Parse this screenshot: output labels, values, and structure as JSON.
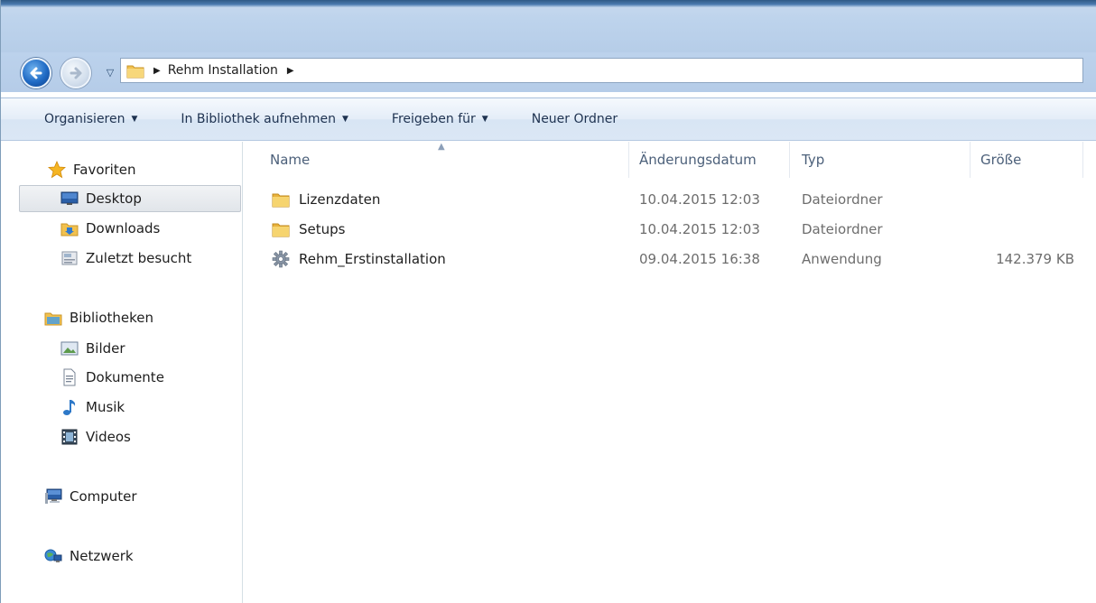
{
  "address": {
    "crumbs": [
      "Rehm Installation"
    ]
  },
  "commands": {
    "organize": "Organisieren",
    "library": "In Bibliothek aufnehmen",
    "share": "Freigeben für",
    "new_folder": "Neuer Ordner"
  },
  "navpane": {
    "favorites": {
      "label": "Favoriten",
      "items": [
        {
          "label": "Desktop",
          "icon": "desktop-icon",
          "selected": true
        },
        {
          "label": "Downloads",
          "icon": "downloads-folder-icon"
        },
        {
          "label": "Zuletzt besucht",
          "icon": "recent-places-icon"
        }
      ]
    },
    "libraries": {
      "label": "Bibliotheken",
      "items": [
        {
          "label": "Bilder",
          "icon": "pictures-icon"
        },
        {
          "label": "Dokumente",
          "icon": "documents-icon"
        },
        {
          "label": "Musik",
          "icon": "music-icon"
        },
        {
          "label": "Videos",
          "icon": "videos-icon"
        }
      ]
    },
    "computer": {
      "label": "Computer"
    },
    "network": {
      "label": "Netzwerk"
    }
  },
  "columns": {
    "name": "Name",
    "date": "Änderungsdatum",
    "type": "Typ",
    "size": "Größe"
  },
  "files": [
    {
      "name": "Lizenzdaten",
      "date": "10.04.2015 12:03",
      "type": "Dateiordner",
      "size": "",
      "icon": "folder-icon"
    },
    {
      "name": "Setups",
      "date": "10.04.2015 12:03",
      "type": "Dateiordner",
      "size": "",
      "icon": "folder-icon"
    },
    {
      "name": "Rehm_Erstinstallation",
      "date": "09.04.2015 16:38",
      "type": "Anwendung",
      "size": "142.379 KB",
      "icon": "setup-gear-icon"
    }
  ],
  "colors": {
    "accent": "#1f6ac4",
    "folder": "#f2c14e",
    "header_text": "#4c607a"
  }
}
